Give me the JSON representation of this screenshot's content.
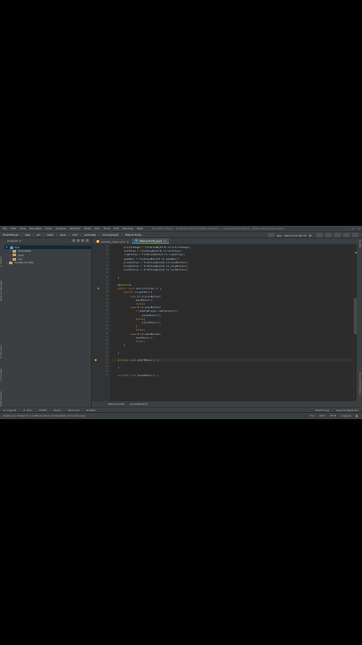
{
  "menu": [
    "File",
    "Edit",
    "View",
    "Navigate",
    "Code",
    "Analyze",
    "Refactor",
    "Build",
    "Run",
    "Tools",
    "VCS",
    "Window",
    "Help"
  ],
  "window_title": "My Music Player - D:\\Android\\Android\\MusicPlayer - ...\\app\\src\\main\\java\\...\\MainActivity.java [app]",
  "nav": {
    "crumbs": [
      "MusicPlayer",
      "app",
      "src",
      "main",
      "java",
      "com",
      "example",
      "musicplayer",
      "MainActivity"
    ],
    "run_config": "app",
    "device": "Nexus 5X API 29"
  },
  "project_panel": {
    "header": "Android",
    "tree": [
      {
        "label": "app",
        "indent": 0,
        "selected": true,
        "color": "blue"
      },
      {
        "label": "manifests",
        "indent": 1,
        "selected": false,
        "color": "gold"
      },
      {
        "label": "java",
        "indent": 1,
        "selected": false,
        "color": "gold"
      },
      {
        "label": "res",
        "indent": 1,
        "selected": false,
        "color": "gold"
      },
      {
        "label": "Gradle Scripts",
        "indent": 0,
        "selected": false,
        "color": "gold"
      }
    ]
  },
  "left_tool_labels": [
    "1: Project",
    "Resource Manager",
    "Z: Structure",
    "2: Favorites",
    "Build Variants",
    "Layout Captures"
  ],
  "right_tool_labels": [
    "Gradle",
    "Device File Explorer"
  ],
  "tabs": [
    {
      "label": "activity_main.xml",
      "active": false,
      "icon": "xml"
    },
    {
      "label": "MainActivity.java",
      "active": true,
      "icon": "java"
    }
  ],
  "code_lines": [
    {
      "ln": "33",
      "text": "        artistImage = findViewById(R.id.artistImage);",
      "cls": ""
    },
    {
      "ln": "34",
      "text": "        leftView = findViewById(R.id.leftView);",
      "cls": ""
    },
    {
      "ln": "35",
      "text": "        rightView = findViewById(R.id.rightView);",
      "cls": ""
    },
    {
      "ln": "36",
      "text": "        seekBar = findViewById(R.id.seekBar);",
      "cls": ""
    },
    {
      "ln": "37",
      "text": "        prevButton = findViewById(R.id.prevButton);",
      "cls": ""
    },
    {
      "ln": "38",
      "text": "        playButton = findViewById(R.id.playButton);",
      "cls": ""
    },
    {
      "ln": "39",
      "text": "        nextButton = findViewById(R.id.nextButton);",
      "cls": ""
    },
    {
      "ln": "40",
      "text": "",
      "cls": ""
    },
    {
      "ln": "41",
      "text": "    }",
      "cls": ""
    },
    {
      "ln": "42",
      "text": "",
      "cls": ""
    },
    {
      "ln": "43",
      "text": "    @Override",
      "cls": "ann"
    },
    {
      "ln": "44",
      "text": "    public void onClick(View v) {",
      "cls": ""
    },
    {
      "ln": "45",
      "text": "        switch (v.getId()){",
      "cls": ""
    },
    {
      "ln": "46",
      "text": "            case R.id.prevButton:",
      "cls": ""
    },
    {
      "ln": "47",
      "text": "                backMusic();",
      "cls": ""
    },
    {
      "ln": "48",
      "text": "                break;",
      "cls": ""
    },
    {
      "ln": "49",
      "text": "            case R.id.playButton:",
      "cls": ""
    },
    {
      "ln": "50",
      "text": "                if(mediaPlayer.isPlaying()){",
      "cls": ""
    },
    {
      "ln": "51",
      "text": "                    pauseMusic();",
      "cls": ""
    },
    {
      "ln": "52",
      "text": "                }else{",
      "cls": ""
    },
    {
      "ln": "53",
      "text": "                    startMusic();",
      "cls": ""
    },
    {
      "ln": "54",
      "text": "                }",
      "cls": ""
    },
    {
      "ln": "55",
      "text": "                break;",
      "cls": ""
    },
    {
      "ln": "56",
      "text": "            case R.id.nextButton:",
      "cls": ""
    },
    {
      "ln": "57",
      "text": "                nextMusic();",
      "cls": ""
    },
    {
      "ln": "58",
      "text": "                break;",
      "cls": ""
    },
    {
      "ln": "59",
      "text": "        }",
      "cls": ""
    },
    {
      "ln": "60",
      "text": "",
      "cls": ""
    },
    {
      "ln": "61",
      "text": "    }",
      "cls": ""
    },
    {
      "ln": "62",
      "text": "",
      "cls": ""
    },
    {
      "ln": "63",
      "text": "    private void startMusic() {",
      "cls": ""
    },
    {
      "ln": "64",
      "text": "",
      "cls": ""
    },
    {
      "ln": "65",
      "text": "    }",
      "cls": ""
    },
    {
      "ln": "66",
      "text": "",
      "cls": ""
    },
    {
      "ln": "67",
      "text": "    private void pauseMusic() {",
      "cls": ""
    }
  ],
  "editor_breadcrumbs": [
    "MainActivity",
    "pauseMusic()"
  ],
  "bottom_tools": [
    "6: Logcat",
    "4: Run",
    "TODO",
    "Build",
    "Terminal",
    "Profiler"
  ],
  "bottom_tools_right": [
    "Event Log",
    "Layout Inspector"
  ],
  "status": {
    "message": "Gradle sync finished in 1 s 660 ms (from cached state) (6 minutes ago)",
    "position": "74:1",
    "line_sep": "CRLF",
    "encoding": "UTF-8",
    "indent": "4 spaces"
  },
  "colors": {
    "ide_bg": "#2b2b2b",
    "panel_bg": "#3c3f41",
    "keyword": "#cc7832",
    "annotation": "#bbb529",
    "method": "#ffc66d"
  }
}
